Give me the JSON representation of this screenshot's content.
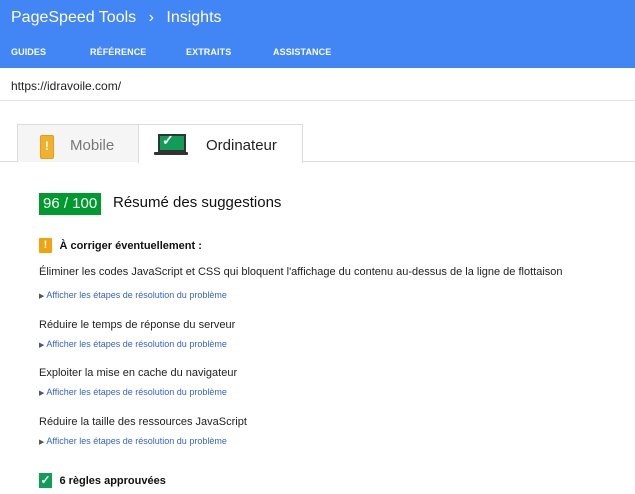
{
  "header": {
    "breadcrumb_1": "PageSpeed Tools",
    "breadcrumb_sep": "›",
    "breadcrumb_2": "Insights",
    "nav": [
      "GUIDES",
      "RÉFÉRENCE",
      "EXTRAITS",
      "ASSISTANCE"
    ]
  },
  "url": "https://idravoile.com/",
  "tabs": {
    "mobile": "Mobile",
    "desktop": "Ordinateur"
  },
  "score": {
    "value": "96 / 100",
    "title": "Résumé des suggestions"
  },
  "warning_section": {
    "icon": "!",
    "title": "À corriger éventuellement :"
  },
  "rules": [
    {
      "title": "Éliminer les codes JavaScript et CSS qui bloquent l'affichage du contenu au-dessus de la ligne de flottaison",
      "link": "Afficher les étapes de résolution du problème"
    },
    {
      "title": "Réduire le temps de réponse du serveur",
      "link": "Afficher les étapes de résolution du problème"
    },
    {
      "title": "Exploiter la mise en cache du navigateur",
      "link": "Afficher les étapes de résolution du problème"
    },
    {
      "title": "Réduire la taille des ressources JavaScript",
      "link": "Afficher les étapes de résolution du problème"
    }
  ],
  "passed": {
    "icon": "✓",
    "text": "6 règles approuvées"
  },
  "colors": {
    "header": "#4285f4",
    "score": "#009a2e",
    "warning": "#f2a20d",
    "link": "#3563c9"
  }
}
